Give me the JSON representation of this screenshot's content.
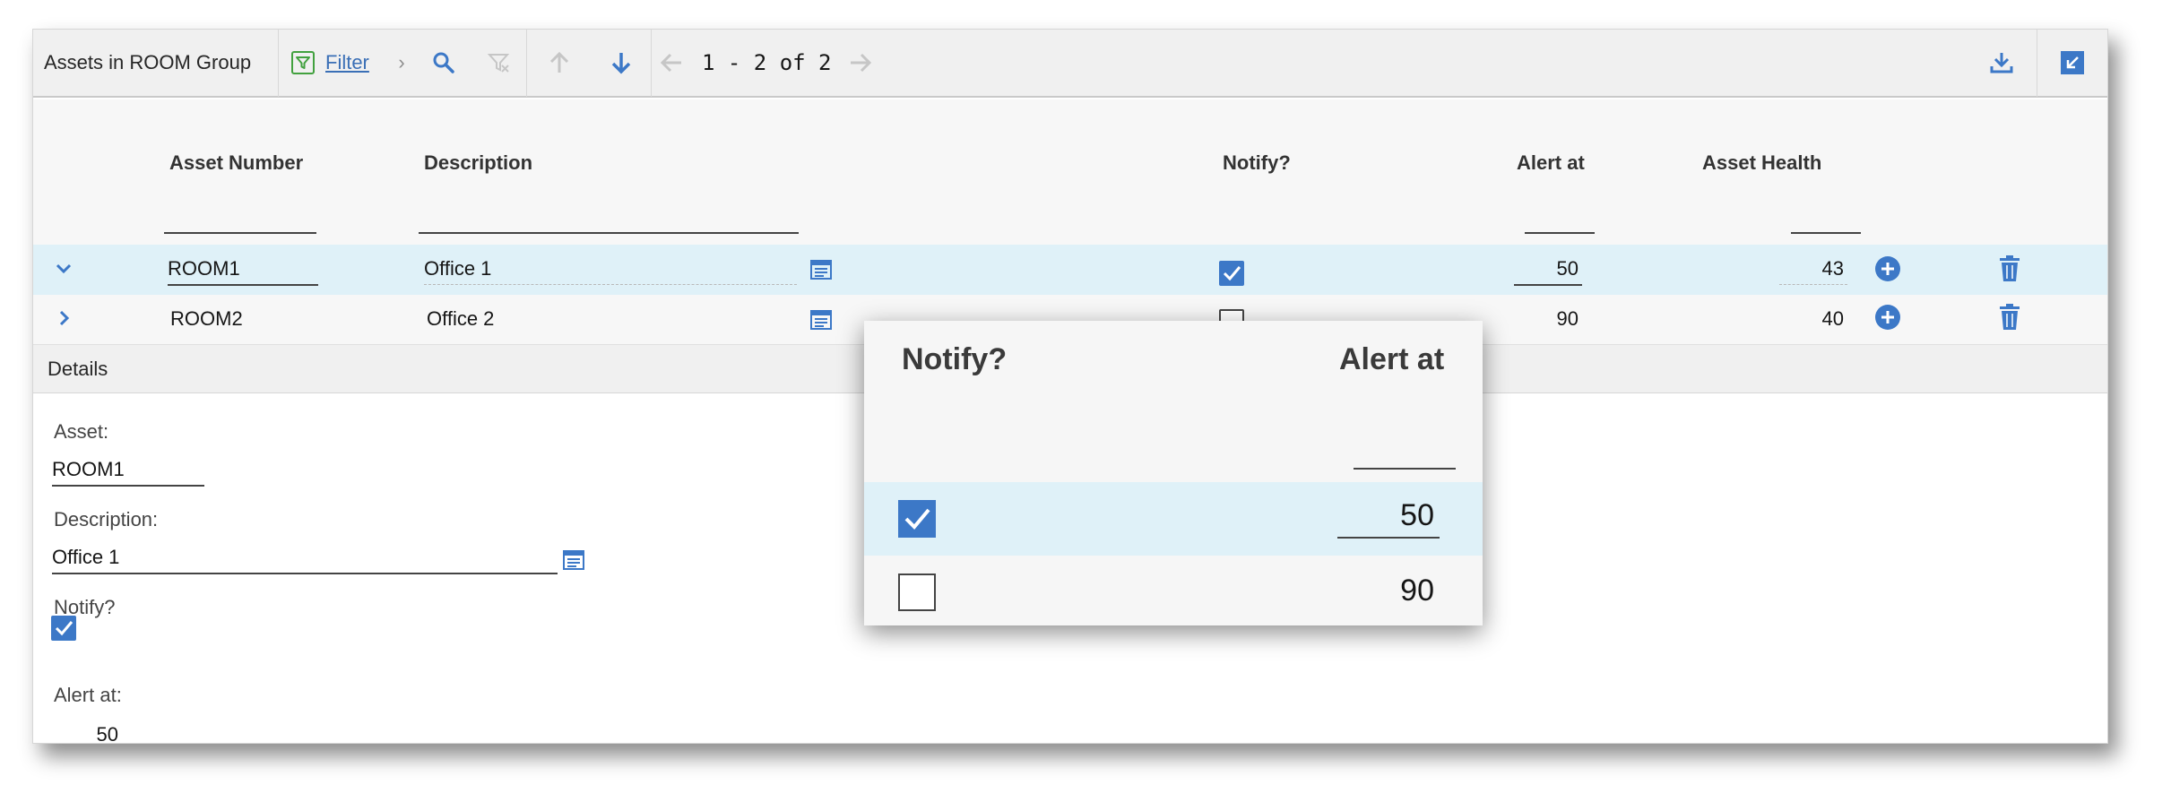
{
  "toolbar": {
    "title": "Assets in ROOM Group",
    "filter_label": "Filter",
    "pager_text": "1 - 2 of 2"
  },
  "columns": {
    "asset_number": "Asset Number",
    "description": "Description",
    "notify": "Notify?",
    "alert_at": "Alert at",
    "asset_health": "Asset Health"
  },
  "rows": [
    {
      "asset": "ROOM1",
      "description": "Office 1",
      "notify": true,
      "alert_at": "50",
      "health": "43",
      "expanded": true
    },
    {
      "asset": "ROOM2",
      "description": "Office 2",
      "notify": false,
      "alert_at": "90",
      "health": "40",
      "expanded": false
    }
  ],
  "details": {
    "title": "Details",
    "asset_label": "Asset:",
    "asset_value": "ROOM1",
    "description_label": "Description:",
    "description_value": "Office 1",
    "notify_label": "Notify?",
    "notify_value": true,
    "alert_label": "Alert at:",
    "alert_value": "50"
  },
  "zoom": {
    "notify_header": "Notify?",
    "alert_header": "Alert at",
    "row1_alert": "50",
    "row2_alert": "90"
  },
  "colors": {
    "accent": "#3c78c7",
    "row_selected": "#dff1f8",
    "filter_green": "#42a13f"
  }
}
